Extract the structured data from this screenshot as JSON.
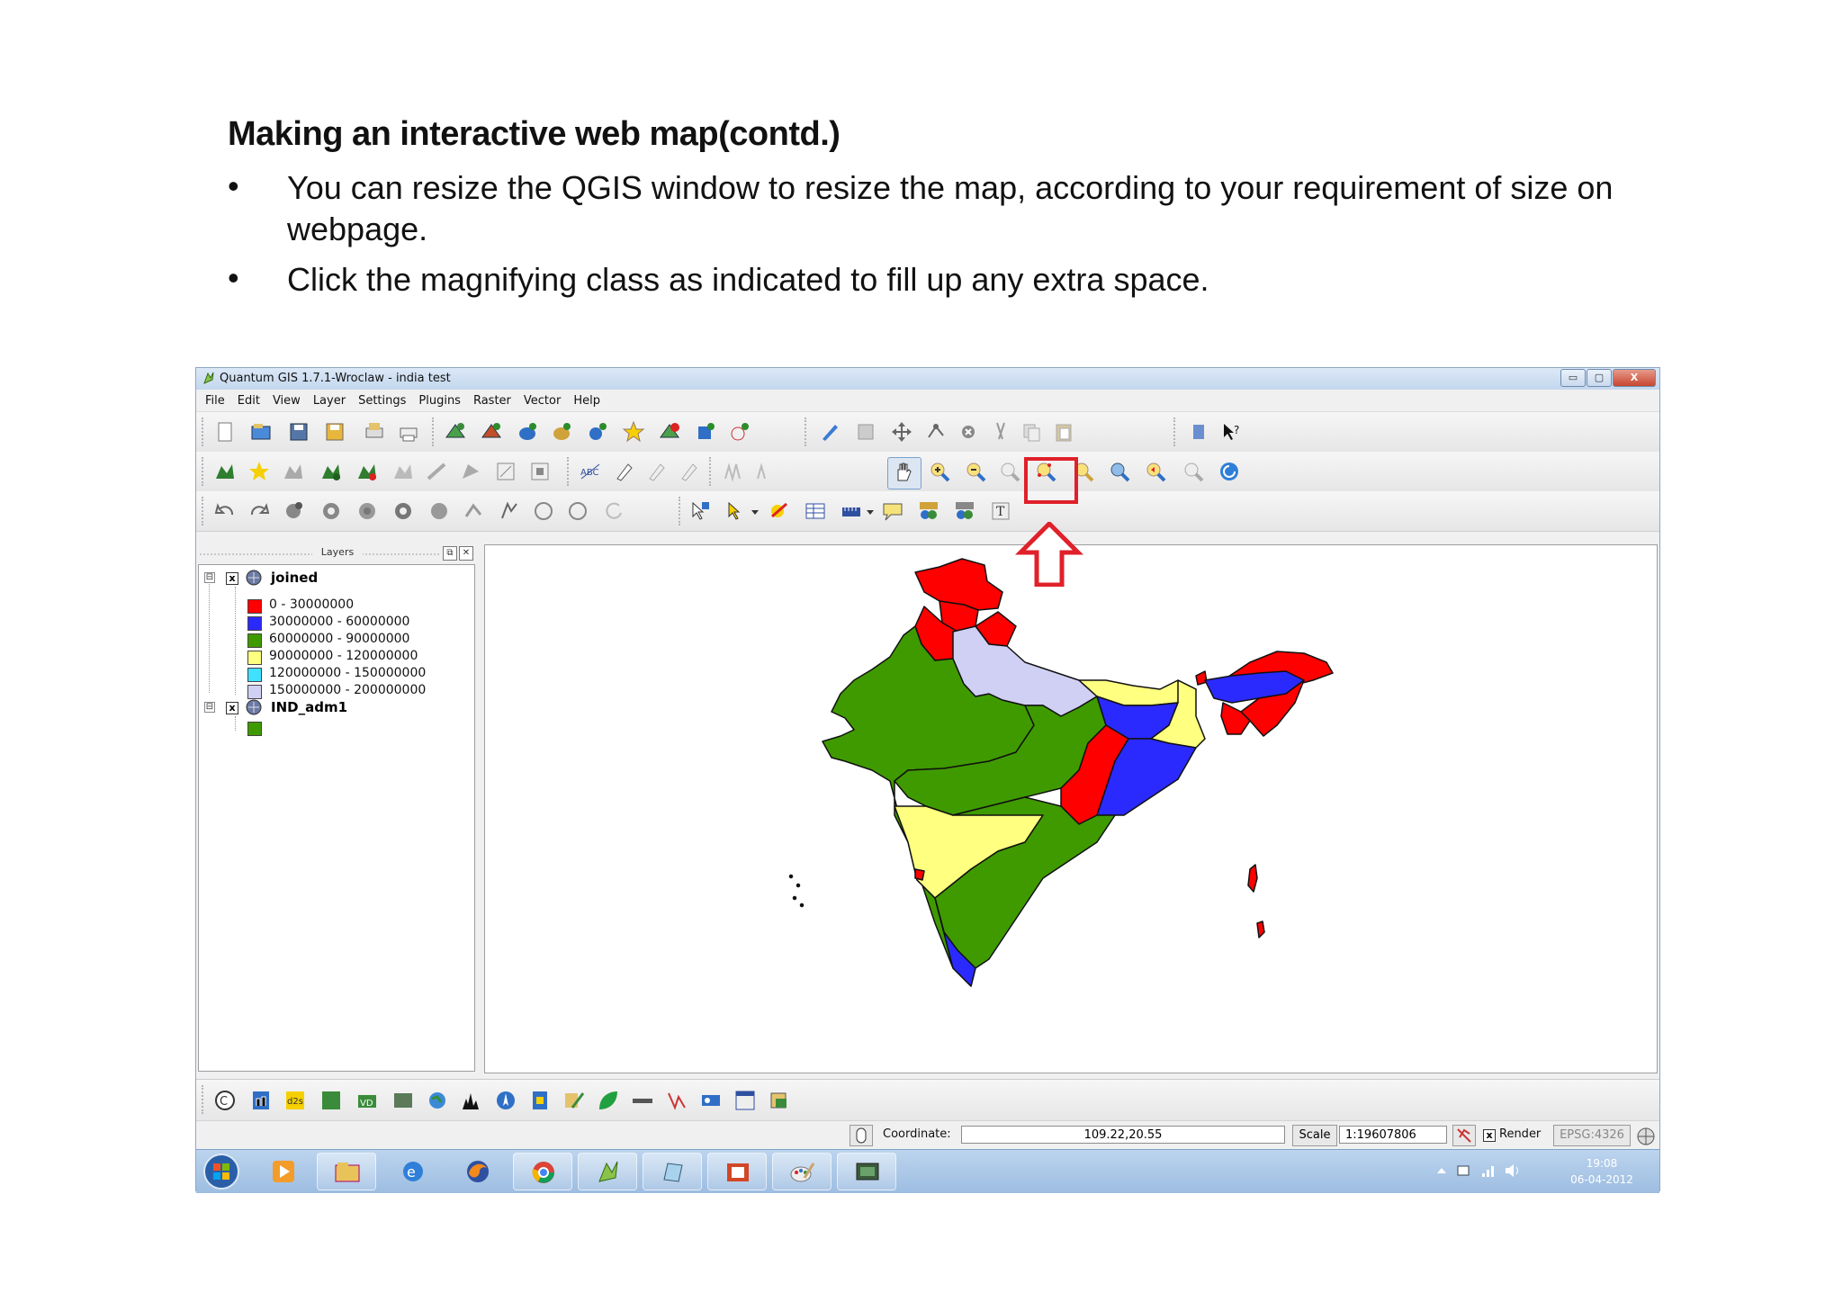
{
  "slide": {
    "title": "Making an interactive web map(contd.)",
    "bullets": [
      "You can resize the QGIS window to resize the map, according to your requirement of size on webpage.",
      "Click the magnifying class as indicated to fill up any extra space."
    ],
    "bullet_marker": "•"
  },
  "window": {
    "title": "Quantum GIS 1.7.1-Wroclaw - india test",
    "controls": {
      "minimize": "▭",
      "maximize": "▢",
      "close": "X"
    }
  },
  "menu": [
    "File",
    "Edit",
    "View",
    "Layer",
    "Settings",
    "Plugins",
    "Raster",
    "Vector",
    "Help"
  ],
  "layers_panel": {
    "title": "Layers",
    "layers": [
      {
        "name": "joined",
        "checked": "x",
        "expander": "⊟",
        "classes": [
          {
            "label": "0 - 30000000",
            "color": "#ff0000"
          },
          {
            "label": "30000000 - 60000000",
            "color": "#2a2aff"
          },
          {
            "label": "60000000 - 90000000",
            "color": "#3f9a00"
          },
          {
            "label": "90000000 - 120000000",
            "color": "#ffff80"
          },
          {
            "label": "120000000 - 150000000",
            "color": "#40e0ff"
          },
          {
            "label": "150000000 - 200000000",
            "color": "#d0d0f4"
          }
        ]
      },
      {
        "name": "IND_adm1",
        "checked": "x",
        "expander": "⊟",
        "symbol_color": "#3f9a00"
      }
    ]
  },
  "statusbar": {
    "coordinate_label": "Coordinate:",
    "coordinate_value": "109.22,20.55",
    "scale_label": "Scale",
    "scale_value": "1:19607806",
    "render_label": "Render",
    "render_checked": "x",
    "crs": "EPSG:4326"
  },
  "taskbar": {
    "clock_time": "19:08",
    "clock_date": "06-04-2012"
  },
  "colors": {
    "highlight": "#e0202a",
    "titlebar": "#c4d7ee",
    "taskbar": "#9dbde1"
  },
  "icons": {
    "highlighted_tool": "zoom-full-icon",
    "annotation": "up-arrow-icon"
  }
}
